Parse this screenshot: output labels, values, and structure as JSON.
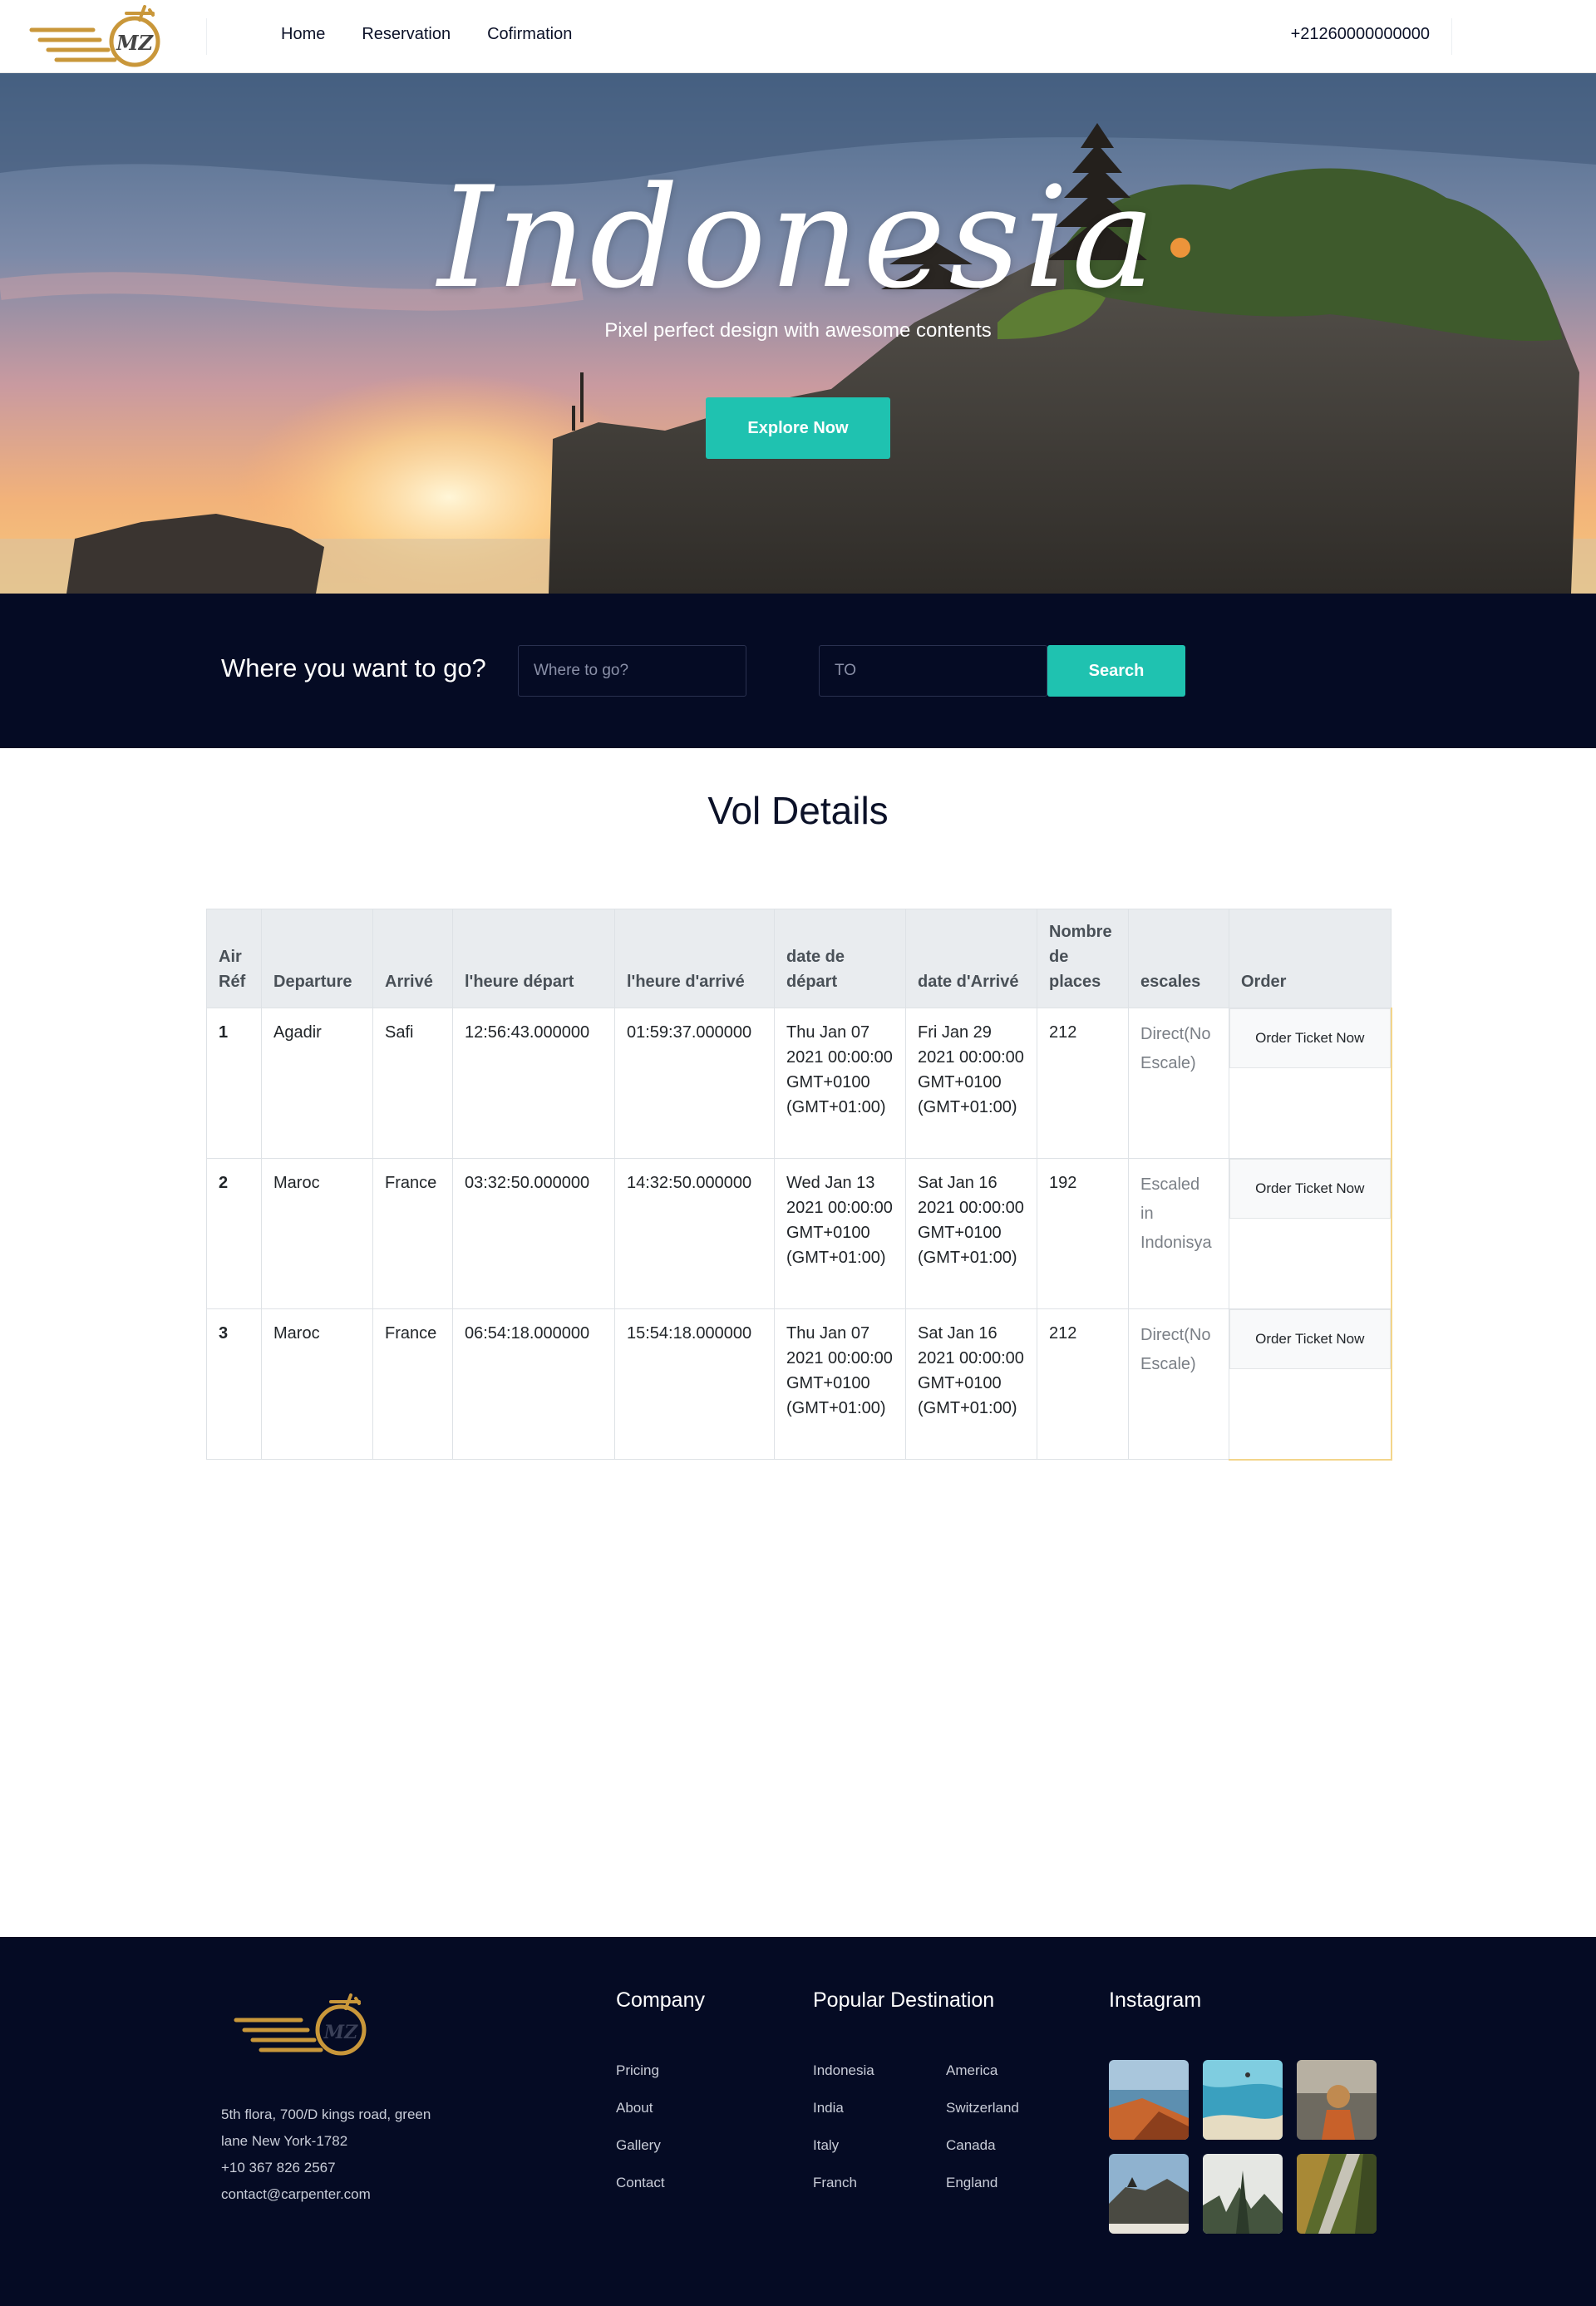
{
  "nav": {
    "links": [
      "Home",
      "Reservation",
      "Cofirmation"
    ],
    "phone": "+21260000000000"
  },
  "hero": {
    "title": "Indonesia",
    "subtitle": "Pixel perfect design with awesome contents",
    "cta": "Explore Now"
  },
  "search": {
    "label": "Where you want to go?",
    "from_placeholder": "Where to go?",
    "to_placeholder": "TO",
    "button": "Search"
  },
  "details": {
    "title": "Vol Details",
    "headers": [
      "Air Réf",
      "Departure",
      "Arrivé",
      "l'heure départ",
      "l'heure d'arrivé",
      "date de départ",
      "date d'Arrivé",
      "Nombre de places",
      "escales",
      "Order"
    ],
    "rows": [
      {
        "ref": "1",
        "departure": "Agadir",
        "arrival": "Safi",
        "dep_time": "12:56:43.000000",
        "arr_time": "01:59:37.000000",
        "dep_date": "Thu Jan 07 2021 00:00:00 GMT+0100 (GMT+01:00)",
        "arr_date": "Fri Jan 29 2021 00:00:00 GMT+0100 (GMT+01:00)",
        "places": "212",
        "escales": "Direct(No Escale)",
        "order": "Order Ticket Now"
      },
      {
        "ref": "2",
        "departure": "Maroc",
        "arrival": "France",
        "dep_time": "03:32:50.000000",
        "arr_time": "14:32:50.000000",
        "dep_date": "Wed Jan 13 2021 00:00:00 GMT+0100 (GMT+01:00)",
        "arr_date": "Sat Jan 16 2021 00:00:00 GMT+0100 (GMT+01:00)",
        "places": "192",
        "escales": "Escaled in Indonisya",
        "order": "Order Ticket Now"
      },
      {
        "ref": "3",
        "departure": "Maroc",
        "arrival": "France",
        "dep_time": "06:54:18.000000",
        "arr_time": "15:54:18.000000",
        "dep_date": "Thu Jan 07 2021 00:00:00 GMT+0100 (GMT+01:00)",
        "arr_date": "Sat Jan 16 2021 00:00:00 GMT+0100 (GMT+01:00)",
        "places": "212",
        "escales": "Direct(No Escale)",
        "order": "Order Ticket Now"
      }
    ]
  },
  "footer": {
    "address": [
      "5th flora, 700/D kings road, green",
      "lane New York-1782",
      "+10 367 826 2567",
      "contact@carpenter.com"
    ],
    "company_title": "Company",
    "company_links": [
      "Pricing",
      "About",
      "Gallery",
      "Contact"
    ],
    "destinations_title": "Popular Destination",
    "destinations_col1": [
      "Indonesia",
      "India",
      "Italy",
      "Franch"
    ],
    "destinations_col2": [
      "America",
      "Switzerland",
      "Canada",
      "England"
    ],
    "instagram_title": "Instagram"
  },
  "colors": {
    "accent": "#1fc2b0",
    "navy": "#050b24",
    "gold": "#c9973a"
  }
}
